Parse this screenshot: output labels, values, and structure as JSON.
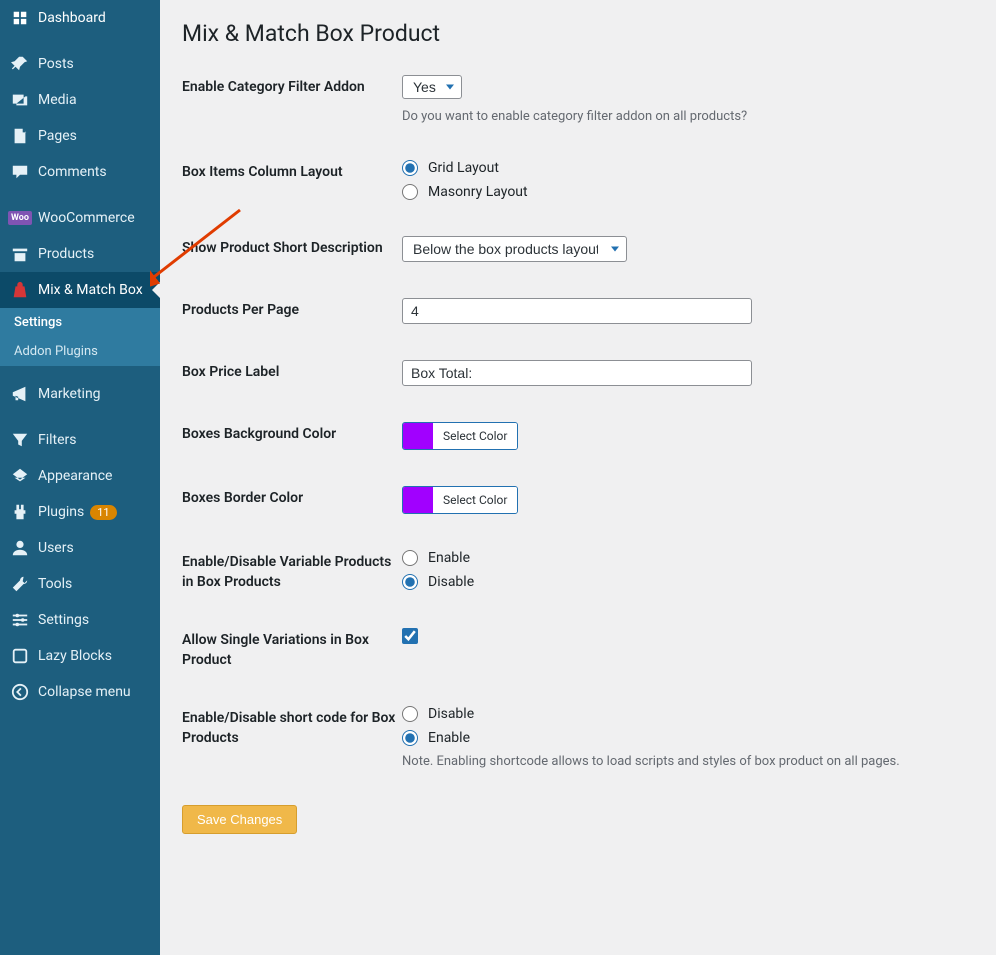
{
  "page_title": "Mix & Match Box Product",
  "sidebar": {
    "items": [
      {
        "icon": "dashboard",
        "label": "Dashboard"
      },
      {
        "icon": "pin",
        "label": "Posts"
      },
      {
        "icon": "media",
        "label": "Media"
      },
      {
        "icon": "page",
        "label": "Pages"
      },
      {
        "icon": "comment",
        "label": "Comments"
      },
      {
        "icon": "woo",
        "label": "WooCommerce"
      },
      {
        "icon": "products",
        "label": "Products"
      },
      {
        "icon": "bag",
        "label": "Mix & Match Box",
        "active": true
      },
      {
        "icon": "marketing",
        "label": "Marketing"
      },
      {
        "icon": "filter",
        "label": "Filters"
      },
      {
        "icon": "appearance",
        "label": "Appearance"
      },
      {
        "icon": "plugin",
        "label": "Plugins",
        "badge": "11"
      },
      {
        "icon": "users",
        "label": "Users"
      },
      {
        "icon": "tools",
        "label": "Tools"
      },
      {
        "icon": "settings",
        "label": "Settings"
      },
      {
        "icon": "lazy",
        "label": "Lazy Blocks"
      },
      {
        "icon": "collapse",
        "label": "Collapse menu"
      }
    ],
    "sub": [
      {
        "label": "Settings",
        "current": true
      },
      {
        "label": "Addon Plugins"
      }
    ]
  },
  "fields": {
    "enable_cf": {
      "label": "Enable Category Filter Addon",
      "value": "Yes",
      "desc": "Do you want to enable category filter addon on all products?"
    },
    "layout": {
      "label": "Box Items Column Layout",
      "opt1": "Grid Layout",
      "opt2": "Masonry Layout"
    },
    "short_desc": {
      "label": "Show Product Short Description",
      "value": "Below the box products layout"
    },
    "ppp": {
      "label": "Products Per Page",
      "value": "4"
    },
    "price_label": {
      "label": "Box Price Label",
      "value": "Box Total:"
    },
    "bg_color": {
      "label": "Boxes Background Color",
      "btn": "Select Color",
      "hex": "#a100ff"
    },
    "border_color": {
      "label": "Boxes Border Color",
      "btn": "Select Color",
      "hex": "#a100ff"
    },
    "variable": {
      "label": "Enable/Disable Variable Products in Box Products",
      "opt1": "Enable",
      "opt2": "Disable"
    },
    "single_var": {
      "label": "Allow Single Variations in Box Product"
    },
    "shortcode": {
      "label": "Enable/Disable short code for Box Products",
      "opt1": "Disable",
      "opt2": "Enable",
      "note": "Note. Enabling shortcode allows to load scripts and styles of box product on all pages."
    },
    "save": "Save Changes"
  }
}
